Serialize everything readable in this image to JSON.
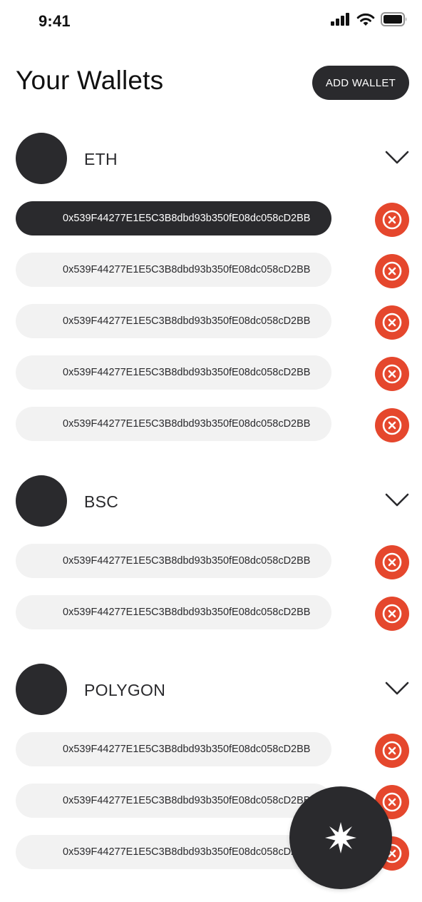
{
  "status_bar": {
    "time": "9:41",
    "icons": [
      "cellular-signal-icon",
      "wifi-icon",
      "battery-icon"
    ]
  },
  "header": {
    "title": "Your Wallets",
    "add_wallet_label": "ADD WALLET"
  },
  "colors": {
    "dark": "#2a2a2d",
    "pill_background": "#f2f2f2",
    "remove_red": "#e5472d"
  },
  "sections": [
    {
      "chain": "ETH",
      "wallets": [
        {
          "address": "0x539F44277E1E5C3B8dbd93b350fE08dc058cD2BB",
          "selected": true
        },
        {
          "address": "0x539F44277E1E5C3B8dbd93b350fE08dc058cD2BB",
          "selected": false
        },
        {
          "address": "0x539F44277E1E5C3B8dbd93b350fE08dc058cD2BB",
          "selected": false
        },
        {
          "address": "0x539F44277E1E5C3B8dbd93b350fE08dc058cD2BB",
          "selected": false
        },
        {
          "address": "0x539F44277E1E5C3B8dbd93b350fE08dc058cD2BB",
          "selected": false
        }
      ]
    },
    {
      "chain": "BSC",
      "wallets": [
        {
          "address": "0x539F44277E1E5C3B8dbd93b350fE08dc058cD2BB",
          "selected": false
        },
        {
          "address": "0x539F44277E1E5C3B8dbd93b350fE08dc058cD2BB",
          "selected": false
        }
      ]
    },
    {
      "chain": "POLYGON",
      "wallets": [
        {
          "address": "0x539F44277E1E5C3B8dbd93b350fE08dc058cD2BB",
          "selected": false
        },
        {
          "address": "0x539F44277E1E5C3B8dbd93b350fE08dc058cD2BB",
          "selected": false
        },
        {
          "address": "0x539F44277E1E5C3B8dbd93b350fE08dc058cD2BB",
          "selected": false
        }
      ]
    }
  ],
  "fab": {
    "icon": "sparkle-star-icon"
  }
}
